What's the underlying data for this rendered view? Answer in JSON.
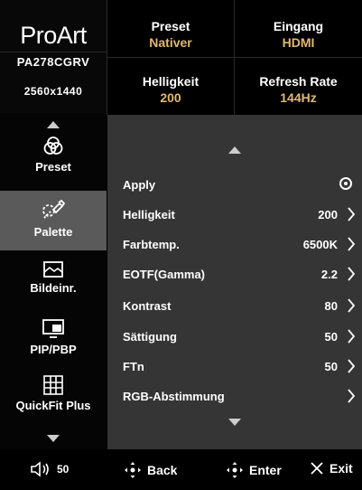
{
  "header": {
    "brand": "ProArt",
    "model": "PA278CGRV",
    "resolution": "2560x1440",
    "preset": {
      "label": "Preset",
      "value": "Nativer"
    },
    "input": {
      "label": "Eingang",
      "value": "HDMI"
    },
    "brightness": {
      "label": "Helligkeit",
      "value": "200"
    },
    "refresh": {
      "label": "Refresh Rate",
      "value": "144Hz"
    }
  },
  "sidebar": {
    "items": [
      {
        "label": "Preset",
        "icon": "preset-icon"
      },
      {
        "label": "Palette",
        "icon": "palette-icon",
        "selected": true
      },
      {
        "label": "Bildeinr.",
        "icon": "image-icon"
      },
      {
        "label": "PIP/PBP",
        "icon": "pip-icon"
      },
      {
        "label": "QuickFit Plus",
        "icon": "grid-icon"
      }
    ],
    "volume": "50"
  },
  "menu": {
    "items": [
      {
        "label": "Apply",
        "value": ""
      },
      {
        "label": "Helligkeit",
        "value": "200"
      },
      {
        "label": "Farbtemp.",
        "value": "6500K"
      },
      {
        "label": "EOTF(Gamma)",
        "value": "2.2"
      },
      {
        "label": "Kontrast",
        "value": "80"
      },
      {
        "label": "Sättigung",
        "value": "50"
      },
      {
        "label": "FTn",
        "value": "50"
      },
      {
        "label": "RGB-Abstimmung",
        "value": ""
      }
    ]
  },
  "footer": {
    "back": "Back",
    "enter": "Enter",
    "exit": "Exit"
  },
  "colors": {
    "accent": "#e0b970",
    "panel": "#353535",
    "selected": "#5a5a5a"
  }
}
